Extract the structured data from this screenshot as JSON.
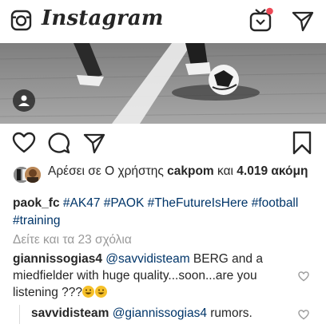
{
  "app": {
    "brand": "Instagram"
  },
  "colors": {
    "text": "#262626",
    "hashtag": "#003569",
    "muted": "#999999",
    "notification": "#ed4956"
  },
  "icons": {
    "camera": "camera-icon",
    "igtv": "igtv-icon",
    "direct": "direct-message-icon",
    "like": "heart-icon",
    "comment": "comment-icon",
    "share": "share-icon",
    "save": "bookmark-icon",
    "tag": "user-tag-icon"
  },
  "post": {
    "likes": {
      "prefix": "Αρέσει σε ",
      "user_prefix": "Ο χρήστης ",
      "user": "cakpom",
      "middle": " και ",
      "count": "4.019",
      "suffix": " ακόμη"
    },
    "caption": {
      "user": "paok_fc",
      "tags": [
        "#AK47",
        "#PAOK",
        "#TheFutureIsHere",
        "#football",
        "#training"
      ]
    },
    "view_all_comments": "Δείτε και τα 23 σχόλια",
    "comments": [
      {
        "user": "giannissogias4",
        "mention": "@savvidisteam",
        "text": " BERG and a miedfielder with huge quality...soon...are you listening ???"
      }
    ],
    "reply": {
      "user": "savvidisteam",
      "mention": "@giannissogias4",
      "text": " rumors."
    }
  }
}
